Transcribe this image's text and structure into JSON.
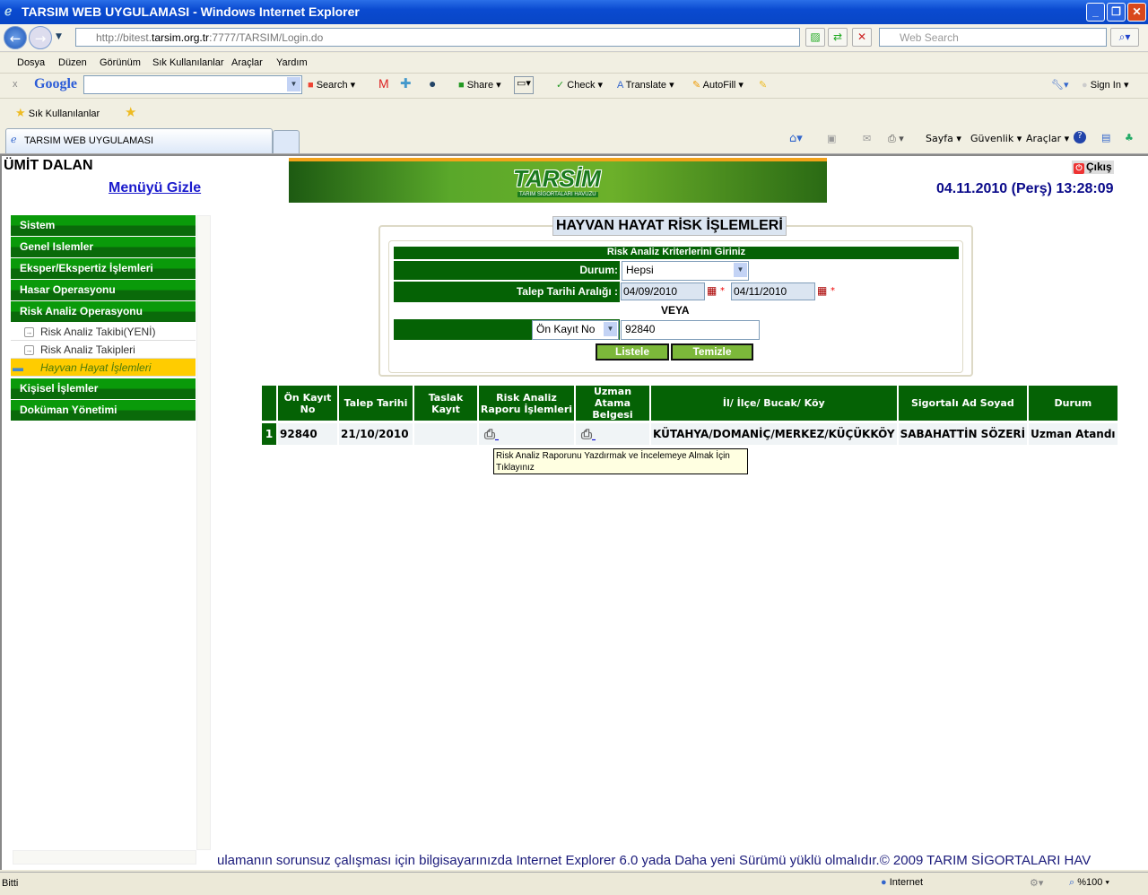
{
  "window": {
    "title": "TARSIM WEB UYGULAMASI - Windows Internet Explorer",
    "minimize": "_",
    "restore": "❐",
    "close": "✕"
  },
  "address": {
    "prefix": "http://bitest.",
    "host": "tarsim.org.tr",
    "suffix": ":7777/TARSIM/Login.do",
    "search_placeholder": "Web Search"
  },
  "menu": [
    "Dosya",
    "Düzen",
    "Görünüm",
    "Sık Kullanılanlar",
    "Araçlar",
    "Yardım"
  ],
  "google_toolbar": {
    "brand": "Google",
    "search": "Search",
    "share": "Share",
    "check": "Check",
    "translate": "Translate",
    "autofill": "AutoFill",
    "sign_in": "Sign In"
  },
  "favorites": {
    "label": "Sık Kullanılanlar"
  },
  "tab": {
    "title": "TARSIM WEB UYGULAMASI"
  },
  "command_bar": {
    "page": "Sayfa",
    "security": "Güvenlik",
    "tools": "Araçlar"
  },
  "header": {
    "user": "ÜMİT DALAN",
    "hide_menu": "Menüyü Gizle",
    "logo": "TARSİM",
    "logo_sub": "TARIM SİGORTALARI HAVUZU",
    "logout": "Çıkış",
    "datetime": "04.11.2010 (Perş) 13:28:09"
  },
  "sidebar": {
    "items": [
      {
        "label": "Sistem",
        "type": "header"
      },
      {
        "label": "Genel Islemler",
        "type": "header"
      },
      {
        "label": "Eksper/Ekspertiz İşlemleri",
        "type": "header"
      },
      {
        "label": "Hasar Operasyonu",
        "type": "header"
      },
      {
        "label": "Risk Analiz Operasyonu",
        "type": "header"
      },
      {
        "label": "Risk Analiz Takibi(YENİ)",
        "type": "sub"
      },
      {
        "label": "Risk Analiz Takipleri",
        "type": "sub"
      },
      {
        "label": "Hayvan Hayat İşlemleri",
        "type": "active"
      },
      {
        "label": "Kişisel İşlemler",
        "type": "header"
      },
      {
        "label": "Doküman Yönetimi",
        "type": "header"
      }
    ]
  },
  "form": {
    "title": "HAYVAN HAYAT RİSK İŞLEMLERİ",
    "criteria_header": "Risk Analiz Kriterlerini Giriniz",
    "durum_label": "Durum:",
    "durum_value": "Hepsi",
    "date_label": "Talep Tarihi Aralığı :",
    "date_from": "04/09/2010",
    "date_to": "04/11/2010",
    "or_label": "VEYA",
    "field_select": "Ön Kayıt No",
    "field_value": "92840",
    "list_button": "Listele",
    "clear_button": "Temizle"
  },
  "table": {
    "columns": [
      "",
      "Ön Kayıt No",
      "Talep Tarihi",
      "Taslak Kayıt",
      "Risk Analiz Raporu İşlemleri",
      "Uzman Atama Belgesi",
      "İl/ İlçe/ Bucak/ Köy",
      "Sigortalı Ad Soyad",
      "Durum"
    ],
    "rows": [
      {
        "index": "1",
        "on_kayit_no": "92840",
        "talep_tarihi": "21/10/2010",
        "taslak_kayit": "",
        "location": "KÜTAHYA/DOMANİÇ/MERKEZ/KÜÇÜKKÖY",
        "insured": "SABAHATTİN SÖZERİ",
        "status": "Uzman Atandı"
      }
    ]
  },
  "tooltip": "Risk Analiz Raporunu Yazdırmak ve İncelemeye Almak İçin Tıklayınız",
  "footer": "ulamanın sorunsuz çalışması için bilgisayarınızda Internet Explorer 6.0 yada Daha yeni Sürümü yüklü olmalıdır.© 2009 TARIM SİGORTALARI HAV",
  "statusbar": {
    "text": "Bitti",
    "zone": "Internet",
    "zoom": "%100"
  }
}
